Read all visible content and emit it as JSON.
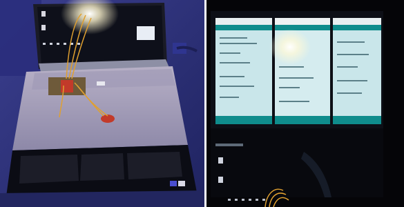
{
  "panels": {
    "left": {
      "subject": "laptop-with-breadboard-circuit"
    },
    "right": {
      "subject": "monitor-with-three-ide-windows"
    }
  },
  "colors": {
    "background_left": "#2b2f78",
    "background_right": "#050508",
    "screen_dark": "#0d0f16",
    "ide_teal": "#0f8c8c",
    "ide_body": "#c9e6ea",
    "wire_orange": "#e0a030",
    "board_red": "#c23a2a",
    "glare": "#ffffff"
  }
}
